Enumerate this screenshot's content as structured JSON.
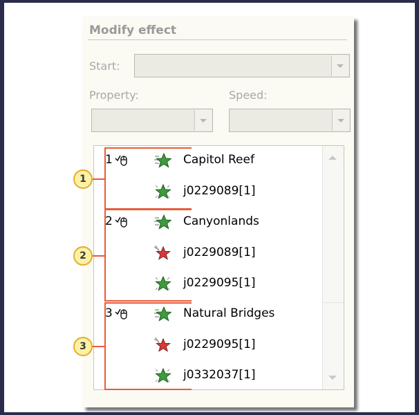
{
  "panel": {
    "section_title": "Modify effect",
    "start_label": "Start:",
    "property_label": "Property:",
    "speed_label": "Speed:",
    "start_value": "",
    "property_value": "",
    "speed_value": ""
  },
  "list": {
    "items": [
      {
        "number": "1",
        "name": "Capitol Reef",
        "icon": "entrance-star-icon"
      },
      {
        "number": "",
        "name": "j0229089[1]",
        "icon": "emphasis-star-icon"
      },
      {
        "number": "2",
        "name": "Canyonlands",
        "icon": "entrance-star-icon"
      },
      {
        "number": "",
        "name": "j0229089[1]",
        "icon": "exit-star-icon"
      },
      {
        "number": "",
        "name": "j0229095[1]",
        "icon": "emphasis-star-icon"
      },
      {
        "number": "3",
        "name": "Natural Bridges",
        "icon": "entrance-star-icon"
      },
      {
        "number": "",
        "name": "j0229095[1]",
        "icon": "exit-star-icon"
      },
      {
        "number": "",
        "name": "j0332037[1]",
        "icon": "emphasis-star-icon"
      }
    ]
  },
  "callouts": [
    "1",
    "2",
    "3"
  ],
  "colors": {
    "highlight": "#e95a3a",
    "callout_fill": "#fdf1a4",
    "callout_border": "#e1ae2f",
    "star_green": "#3f9a3f",
    "star_red": "#d83838"
  }
}
